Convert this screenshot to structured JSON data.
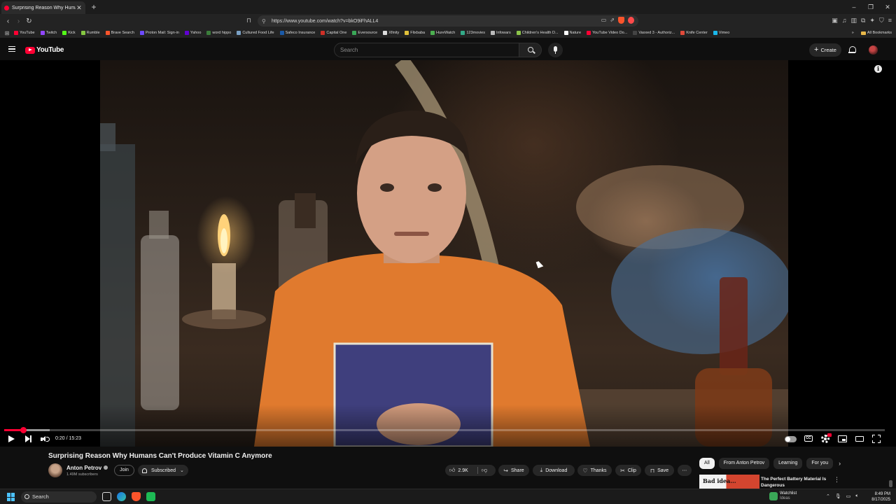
{
  "browser": {
    "tab_title": "Surprising Reason Why Humans",
    "url": "https://www.youtube.com/watch?v=bkO9iFhALL4",
    "bookmarks": [
      {
        "label": "YouTube",
        "color": "#ff0033"
      },
      {
        "label": "Twitch",
        "color": "#9146ff"
      },
      {
        "label": "Kick",
        "color": "#53fc18"
      },
      {
        "label": "Rumble",
        "color": "#85c742"
      },
      {
        "label": "Brave Search",
        "color": "#fb542b"
      },
      {
        "label": "Proton Mail: Sign-in",
        "color": "#6d4aff"
      },
      {
        "label": "Yahoo",
        "color": "#6001d2"
      },
      {
        "label": "word hippo",
        "color": "#3b7d3b"
      },
      {
        "label": "Cultured Food Life",
        "color": "#7aa0c4"
      },
      {
        "label": "Safeco Insurance",
        "color": "#1a5aa8"
      },
      {
        "label": "Capital One",
        "color": "#d03027"
      },
      {
        "label": "Eversource",
        "color": "#3aa757"
      },
      {
        "label": "Xfinity",
        "color": "#dddddd"
      },
      {
        "label": "Flixbaba",
        "color": "#e0c03a"
      },
      {
        "label": "HureWatch",
        "color": "#4caf50"
      },
      {
        "label": "123movies",
        "color": "#33aa88"
      },
      {
        "label": "Infowars",
        "color": "#bbbbbb"
      },
      {
        "label": "Children's Health D...",
        "color": "#8bc34a"
      },
      {
        "label": "Nature",
        "color": "#ffffff"
      },
      {
        "label": "YouTube Video Do...",
        "color": "#ff0033"
      },
      {
        "label": "Vaxxed 3 - Authoriz...",
        "color": "#444444"
      },
      {
        "label": "Knife Center",
        "color": "#e04a3a"
      },
      {
        "label": "Vimeo",
        "color": "#1ab7ea"
      }
    ],
    "all_bookmarks_label": "All Bookmarks"
  },
  "masthead": {
    "logo_text": "YouTube",
    "search_placeholder": "Search",
    "create_label": "Create"
  },
  "player": {
    "current_time": "0:20",
    "duration": "15:23",
    "time_display": "0:20 / 15:23",
    "played_fraction": 0.0217,
    "buffered_fraction": 0.052
  },
  "video": {
    "title": "Surprising Reason Why Humans Can't Produce Vitamin C Anymore",
    "channel_name": "Anton Petrov",
    "subscribers": "1.49M subscribers",
    "join_label": "Join",
    "subscribed_label": "Subscribed",
    "actions": {
      "likes": "2.9K",
      "share": "Share",
      "download": "Download",
      "thanks": "Thanks",
      "clip": "Clip",
      "save": "Save"
    }
  },
  "sidebar": {
    "chips": [
      "All",
      "From Anton Petrov",
      "Learning",
      "For you"
    ],
    "recommendation": {
      "thumb_text": "Bad idea...",
      "title": "The Perfect Battery Material Is Dangerous"
    }
  },
  "taskbar": {
    "search_label": "Search",
    "watch_title": "Watchlist",
    "watch_subtitle": "Ideas",
    "time": "8:49 PM",
    "date": "8/17/2025"
  }
}
